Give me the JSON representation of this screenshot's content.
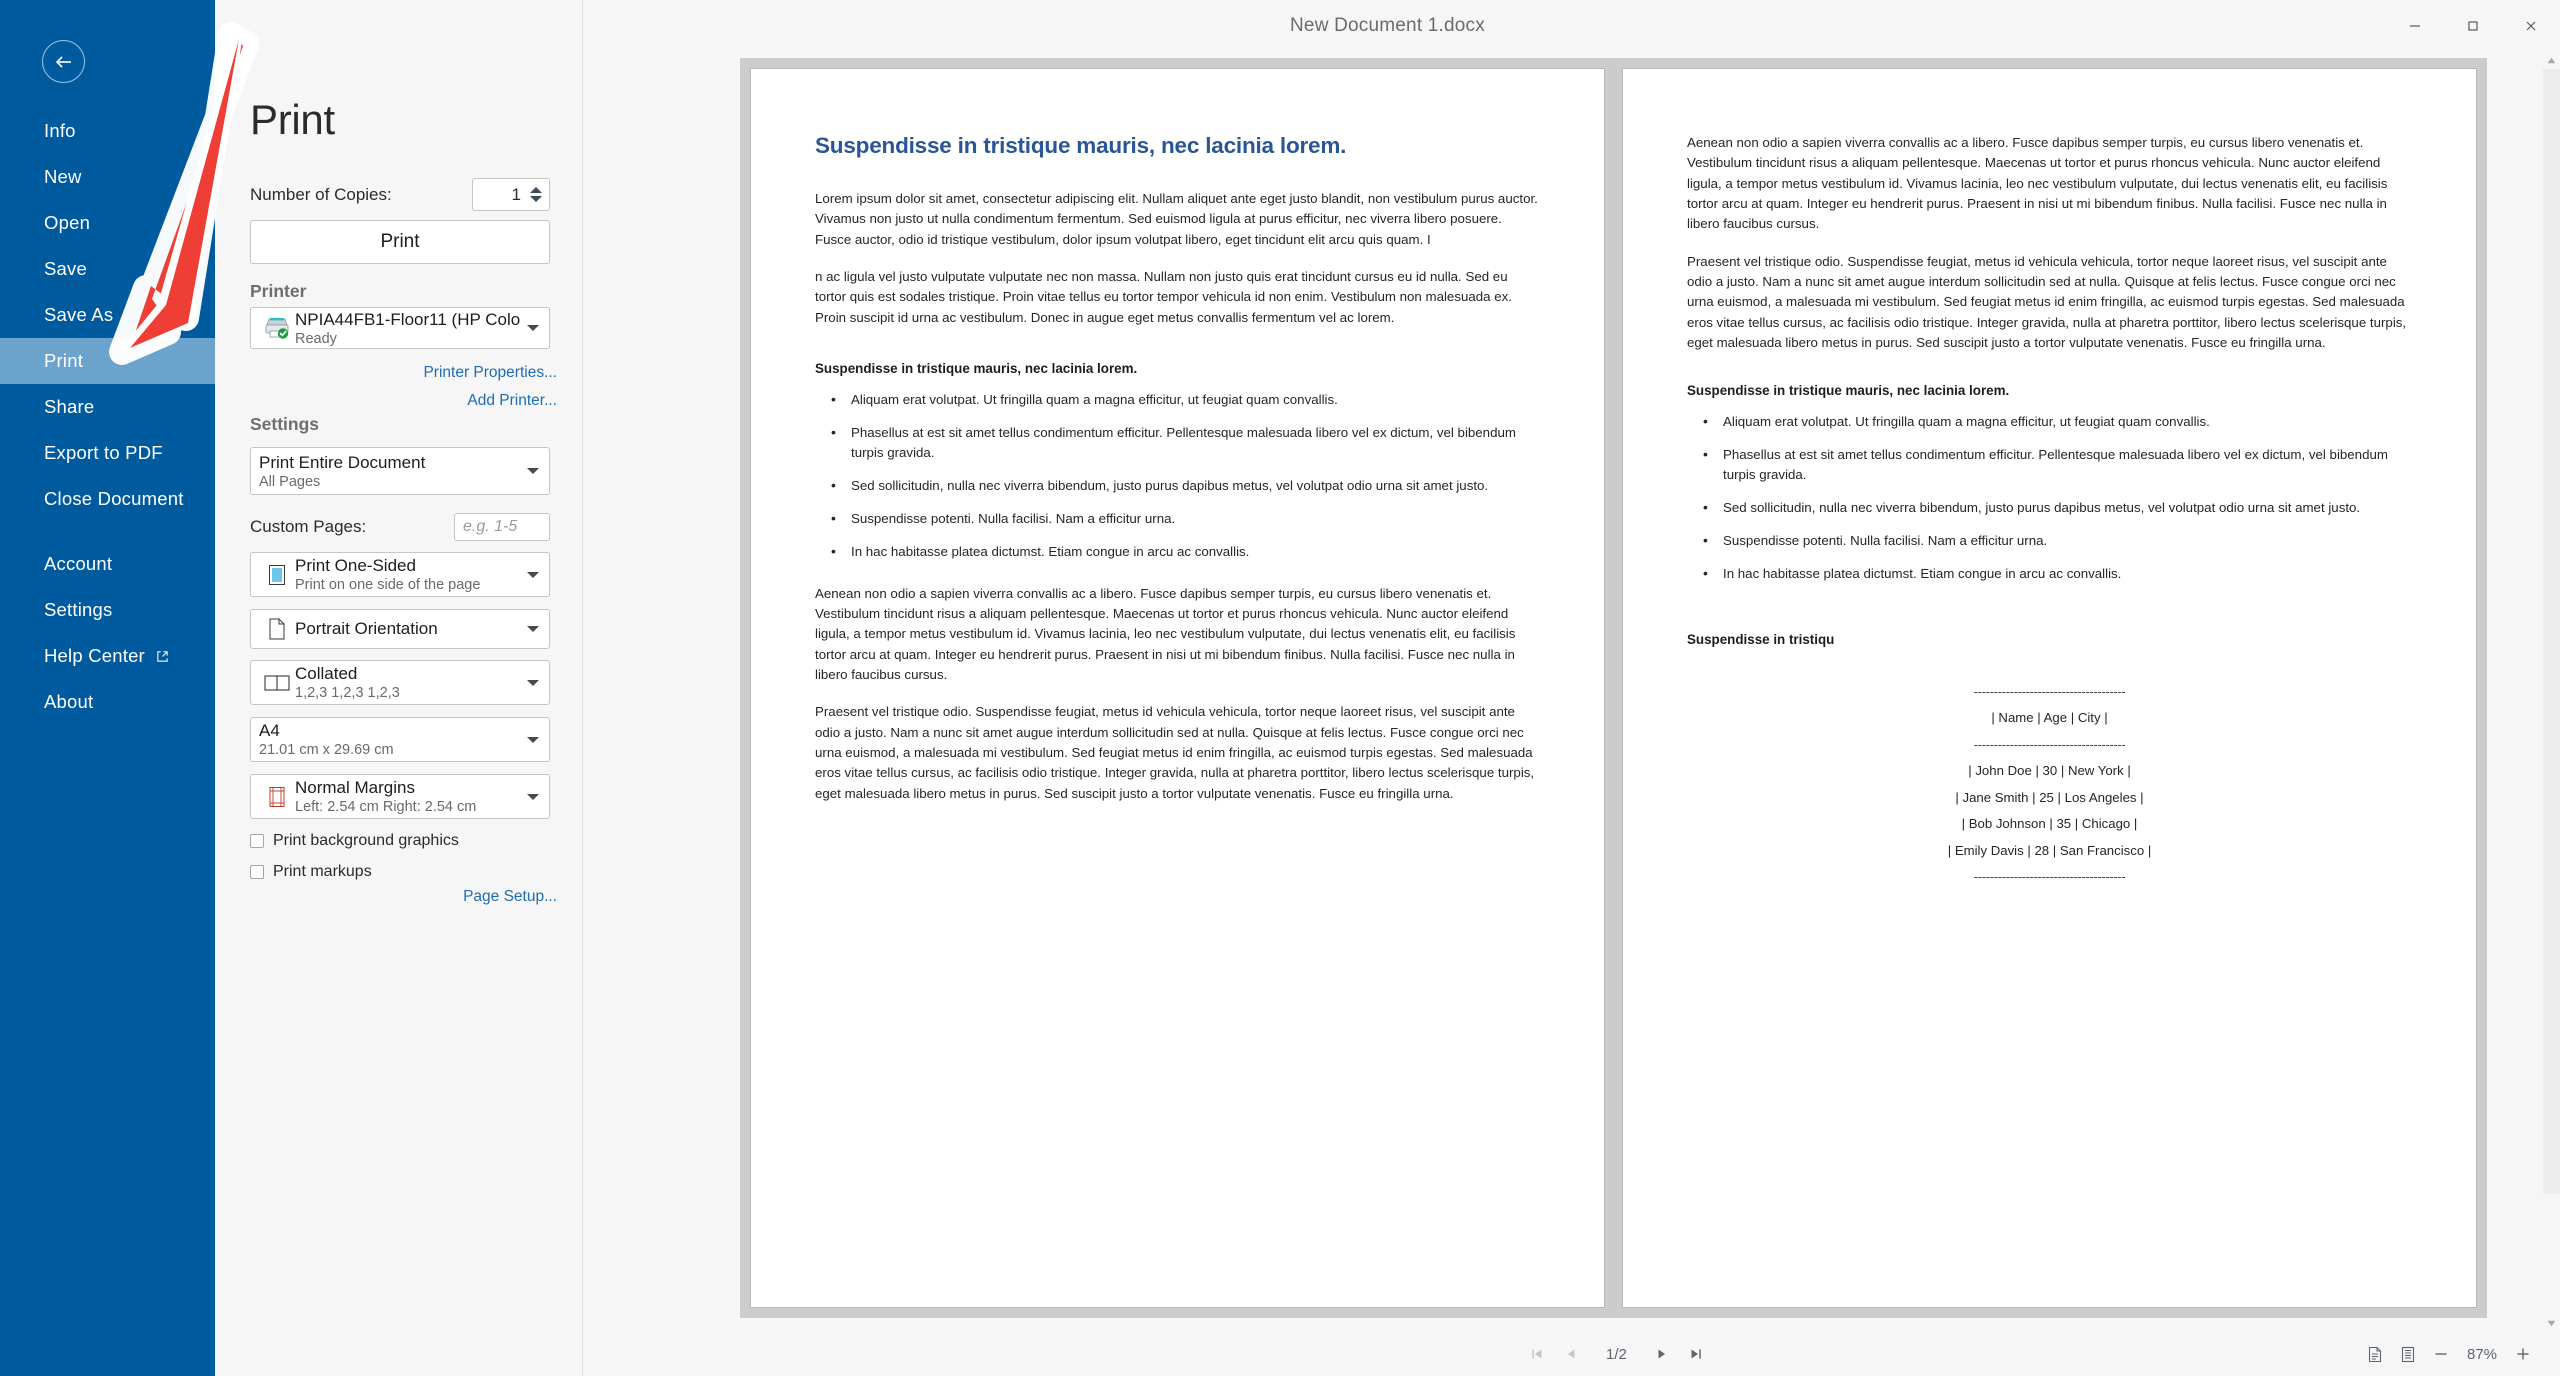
{
  "window": {
    "title": "New Document 1.docx",
    "minimize_label": "Minimize",
    "restore_label": "Restore",
    "close_label": "Close"
  },
  "sidebar": {
    "back_label": "Back",
    "items": [
      {
        "label": "Info",
        "active": false
      },
      {
        "label": "New",
        "active": false
      },
      {
        "label": "Open",
        "active": false
      },
      {
        "label": "Save",
        "active": false
      },
      {
        "label": "Save As",
        "active": false
      },
      {
        "label": "Print",
        "active": true
      },
      {
        "label": "Share",
        "active": false
      },
      {
        "label": "Export to PDF",
        "active": false
      },
      {
        "label": "Close Document",
        "active": false
      },
      {
        "label": "Account",
        "active": false
      },
      {
        "label": "Settings",
        "active": false
      },
      {
        "label": "Help Center",
        "active": false
      },
      {
        "label": "About",
        "active": false
      }
    ]
  },
  "print_panel": {
    "heading": "Print",
    "copies_label": "Number of Copies:",
    "copies_value": "1",
    "print_button": "Print",
    "printer_heading": "Printer",
    "printer_name": "NPIA44FB1-Floor11 (HP Colo...",
    "printer_status": "Ready",
    "printer_properties_link": "Printer Properties...",
    "add_printer_link": "Add Printer...",
    "settings_heading": "Settings",
    "scope_title": "Print Entire Document",
    "scope_sub": "All Pages",
    "custom_pages_label": "Custom Pages:",
    "custom_pages_placeholder": "e.g. 1-5",
    "sided_title": "Print One-Sided",
    "sided_sub": "Print on one side of the page",
    "orientation_title": "Portrait Orientation",
    "collate_title": "Collated",
    "collate_sub": "1,2,3 1,2,3 1,2,3",
    "paper_title": "A4",
    "paper_sub": "21.01 cm x 29.69 cm",
    "margins_title": "Normal Margins",
    "margins_sub": "Left: 2.54 cm Right: 2.54 cm",
    "bg_graphics_label": "Print background graphics",
    "markups_label": "Print markups",
    "page_setup_link": "Page Setup..."
  },
  "statusbar": {
    "first_page_label": "First page",
    "prev_page_label": "Previous page",
    "page_indicator": "1/2",
    "next_page_label": "Next page",
    "last_page_label": "Last page",
    "one_page_label": "One page view",
    "multi_page_label": "Multiple page view",
    "zoom_out_label": "Zoom out",
    "zoom_value": "87%",
    "zoom_in_label": "Zoom in"
  },
  "document": {
    "page1": {
      "h1": "Suspendisse in tristique mauris, nec lacinia lorem.",
      "p1": "Lorem ipsum dolor sit amet, consectetur adipiscing elit. Nullam aliquet ante eget justo blandit, non vestibulum purus auctor. Vivamus non justo ut nulla condimentum fermentum. Sed euismod ligula at purus efficitur, nec viverra libero posuere. Fusce auctor, odio id tristique vestibulum, dolor ipsum volutpat libero, eget tincidunt elit arcu quis quam. I",
      "p2": "n ac ligula vel justo vulputate vulputate nec non massa. Nullam non justo quis erat tincidunt cursus eu id nulla. Sed eu tortor quis est sodales tristique. Proin vitae tellus eu tortor tempor vehicula id non enim. Vestibulum non malesuada ex. Proin suscipit id urna ac vestibulum. Donec in augue eget metus convallis fermentum vel ac lorem.",
      "h2": "Suspendisse in tristique mauris, nec lacinia lorem.",
      "bullets": [
        "Aliquam erat volutpat. Ut fringilla quam a magna efficitur, ut feugiat quam convallis.",
        "Phasellus at est sit amet tellus condimentum efficitur. Pellentesque malesuada libero vel ex dictum, vel bibendum turpis gravida.",
        "Sed sollicitudin, nulla nec viverra bibendum, justo purus dapibus metus, vel volutpat odio urna sit amet justo.",
        "Suspendisse potenti. Nulla facilisi. Nam a efficitur urna.",
        "In hac habitasse platea dictumst. Etiam congue in arcu ac convallis."
      ],
      "p3": "Aenean non odio a sapien viverra convallis ac a libero. Fusce dapibus semper turpis, eu cursus libero venenatis et. Vestibulum tincidunt risus a aliquam pellentesque. Maecenas ut tortor et purus rhoncus vehicula. Nunc auctor eleifend ligula, a tempor metus vestibulum id. Vivamus lacinia, leo nec vestibulum vulputate, dui lectus venenatis elit, eu facilisis tortor arcu at quam. Integer eu hendrerit purus. Praesent in nisi ut mi bibendum finibus. Nulla facilisi. Fusce nec nulla in libero faucibus cursus.",
      "p4": "Praesent vel tristique odio. Suspendisse feugiat, metus id vehicula vehicula, tortor neque laoreet risus, vel suscipit ante odio a justo. Nam a nunc sit amet augue interdum sollicitudin sed at nulla. Quisque at felis lectus. Fusce congue orci nec urna euismod, a malesuada mi vestibulum. Sed feugiat metus id enim fringilla, ac euismod turpis egestas. Sed malesuada eros vitae tellus cursus, ac facilisis odio tristique. Integer gravida, nulla at pharetra porttitor, libero lectus scelerisque turpis, eget malesuada libero metus in purus. Sed suscipit justo a tortor vulputate venenatis. Fusce eu fringilla urna."
    },
    "page2": {
      "p1": "Aenean non odio a sapien viverra convallis ac a libero. Fusce dapibus semper turpis, eu cursus libero venenatis et. Vestibulum tincidunt risus a aliquam pellentesque. Maecenas ut tortor et purus rhoncus vehicula. Nunc auctor eleifend ligula, a tempor metus vestibulum id. Vivamus lacinia, leo nec vestibulum vulputate, dui lectus venenatis elit, eu facilisis tortor arcu at quam. Integer eu hendrerit purus. Praesent in nisi ut mi bibendum finibus. Nulla facilisi. Fusce nec nulla in libero faucibus cursus.",
      "p2": "Praesent vel tristique odio. Suspendisse feugiat, metus id vehicula vehicula, tortor neque laoreet risus, vel suscipit ante odio a justo. Nam a nunc sit amet augue interdum sollicitudin sed at nulla. Quisque at felis lectus. Fusce congue orci nec urna euismod, a malesuada mi vestibulum. Sed feugiat metus id enim fringilla, ac euismod turpis egestas. Sed malesuada eros vitae tellus cursus, ac facilisis odio tristique. Integer gravida, nulla at pharetra porttitor, libero lectus scelerisque turpis, eget malesuada libero metus in purus. Sed suscipit justo a tortor vulputate venenatis. Fusce eu fringilla urna.",
      "h2": "Suspendisse in tristique mauris, nec lacinia lorem.",
      "bullets": [
        "Aliquam erat volutpat. Ut fringilla quam a magna efficitur, ut feugiat quam convallis.",
        "Phasellus at est sit amet tellus condimentum efficitur. Pellentesque malesuada libero vel ex dictum, vel bibendum turpis gravida.",
        "Sed sollicitudin, nulla nec viverra bibendum, justo purus dapibus metus, vel volutpat odio urna sit amet justo.",
        "Suspendisse potenti. Nulla facilisi. Nam a efficitur urna.",
        "In hac habitasse platea dictumst. Etiam congue in arcu ac convallis."
      ],
      "h2b": "Suspendisse in tristiqu",
      "table": {
        "rule_top": "--------------------------------------",
        "header_row": "|  Name    |  Age   |  City  |",
        "rule_mid": "--------------------------------------",
        "rows": [
          "|  John Doe   |   30     |  New York |",
          "|  Jane Smith |   25     |  Los Angeles |",
          "|  Bob Johnson |  35     |   Chicago  |",
          "|  Emily Davis |  28     |  San Francisco |"
        ],
        "rule_bottom": "--------------------------------------"
      }
    }
  },
  "annotation": {
    "arrow_color": "#ef3e36",
    "arrow_outline": "#ffffff",
    "points_to": "Print"
  },
  "colors": {
    "sidebar_blue": "#005a9e",
    "sidebar_active": "#6ba3cc",
    "panel_bg": "#f6f6f6",
    "link_blue": "#1e6bb8",
    "doc_heading_blue": "#2a5696"
  }
}
